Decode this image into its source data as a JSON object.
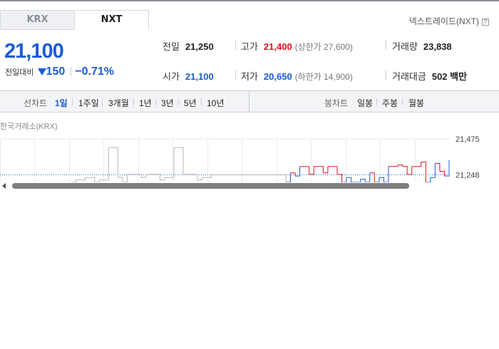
{
  "tabs": [
    {
      "label": "KRX",
      "active": false
    },
    {
      "label": "NXT",
      "active": true
    }
  ],
  "market_link": {
    "label": "넥스트레이드(NXT)",
    "icon": "help-icon",
    "icon_text": "?"
  },
  "quote": {
    "price": "21,100",
    "change_label": "전일대비",
    "change_direction": "down",
    "change_value": "150",
    "change_percent": "−0.71%"
  },
  "stats": {
    "prev_close": {
      "label": "전일",
      "value": "21,250"
    },
    "high": {
      "label": "고가",
      "value": "21,400",
      "limit_text": "(상한가 27,600)"
    },
    "volume": {
      "label": "거래량",
      "value": "23,838"
    },
    "open": {
      "label": "시가",
      "value": "21,100"
    },
    "low": {
      "label": "저가",
      "value": "20,650",
      "limit_text": "(하한가 14,900)"
    },
    "amount": {
      "label": "거래대금",
      "value": "502 백만"
    }
  },
  "chart_menu": {
    "line_label": "선차트",
    "line_periods": [
      "1일",
      "1주일",
      "3개월",
      "1년",
      "3년",
      "5년",
      "10년"
    ],
    "active_period": "1일",
    "candle_label": "봉차트",
    "candle_periods": [
      "일봉",
      "주봉",
      "월봉"
    ]
  },
  "exchange_label": "한국거래소(KRX)",
  "colors": {
    "up": "#e0121c",
    "down": "#1c5bd4",
    "accent": "#1c5bd4"
  },
  "chart_data": {
    "type": "line",
    "y_tick_labels": [
      "21,475",
      "21,248"
    ],
    "reference_line": 21248,
    "ylim": [
      21200,
      21475
    ],
    "grid": true,
    "series": [
      {
        "values": [
          21200,
          21215,
          21215,
          21230,
          21230,
          21200,
          21215,
          21215,
          21420,
          21420,
          21230,
          21200,
          21250,
          21250,
          21250,
          21230,
          21250,
          21250,
          21250,
          21215,
          21230,
          21230,
          21420,
          21420,
          21250,
          21250,
          21250,
          21215,
          21230,
          21230,
          21248,
          21248,
          21248,
          21248,
          21248,
          21248,
          21248,
          21248,
          21248,
          21248,
          21248,
          21248,
          21248,
          21248,
          21248,
          21248,
          21200,
          21260,
          21240,
          21300,
          21300,
          21250,
          21300,
          21300,
          21260,
          21300,
          21300,
          21250,
          21200,
          21230,
          21200,
          21200,
          21220,
          21200,
          21260,
          21200,
          21230,
          21200,
          21300,
          21300,
          21310,
          21300,
          21250,
          21300,
          21300,
          21330,
          21200,
          21230,
          21320,
          21270,
          21240,
          21340
        ]
      }
    ]
  }
}
